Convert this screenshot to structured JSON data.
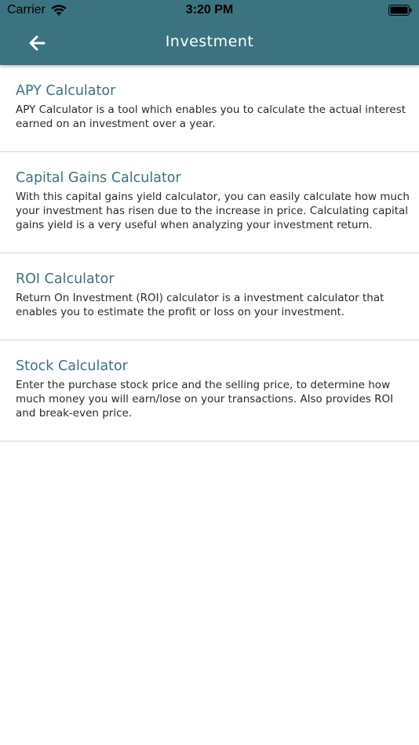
{
  "status_bar": {
    "carrier": "Carrier",
    "time": "3:20 PM",
    "icons": [
      "wifi-icon",
      "battery-icon"
    ]
  },
  "nav": {
    "title": "Investment",
    "back_icon": "arrow-left-icon"
  },
  "colors": {
    "header": "#3b7380",
    "accent_text": "#3b7380",
    "body_text": "#2a2a2a",
    "divider": "#d6d6d6"
  },
  "items": [
    {
      "title": "APY Calculator",
      "description": "APY Calculator is a tool which enables you to calculate the actual interest earned on an investment over a year."
    },
    {
      "title": "Capital Gains Calculator",
      "description": "With this capital gains yield calculator, you can easily calculate how much your investment has risen due to the increase in price. Calculating capital gains yield is a very useful when analyzing your investment return."
    },
    {
      "title": "ROI Calculator",
      "description": "Return On Investment (ROI) calculator is a investment calculator that enables you to estimate the profit or loss on your investment."
    },
    {
      "title": "Stock Calculator",
      "description": "Enter the purchase stock price and the selling price, to determine how much money you will earn/lose on your transactions. Also provides ROI and break-even price."
    }
  ]
}
